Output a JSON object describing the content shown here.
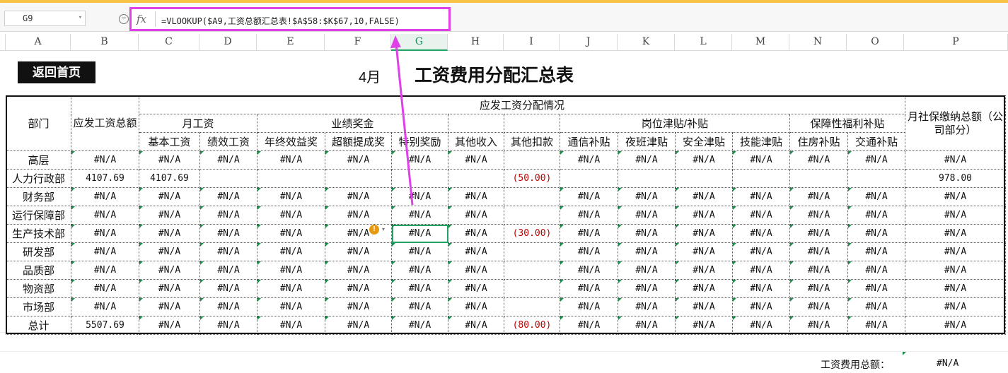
{
  "formula_bar": {
    "cell_ref": "G9",
    "fx_label": "fx",
    "formula": "=VLOOKUP($A9,工资总额汇总表!$A$58:$K$67,10,FALSE)"
  },
  "columns": [
    "A",
    "B",
    "C",
    "D",
    "E",
    "F",
    "G",
    "H",
    "I",
    "J",
    "K",
    "L",
    "M",
    "N",
    "O",
    "P"
  ],
  "selected_column": "G",
  "home_button": "返回首页",
  "month": "4月",
  "title": "工资费用分配汇总表",
  "headers": {
    "dept": "部门",
    "gross": "应发工资总额",
    "distribution": "应发工资分配情况",
    "monthly_wage": "月工资",
    "bonus": "业绩奖金",
    "post_allowance": "岗位津贴/补贴",
    "welfare": "保障性福利补贴",
    "social_security": "月社保缴纳总额（公司部分）",
    "sub": [
      "基本工资",
      "绩效工资",
      "年终效益奖",
      "超额提成奖",
      "特别奖励",
      "其他收入",
      "其他扣款",
      "通信补贴",
      "夜班津贴",
      "安全津贴",
      "技能津贴",
      "住房补贴",
      "交通补贴"
    ]
  },
  "rows": [
    {
      "dept": "高层",
      "cells": [
        "#N/A",
        "#N/A",
        "#N/A",
        "#N/A",
        "#N/A",
        "#N/A",
        "#N/A",
        "",
        "#N/A",
        "#N/A",
        "#N/A",
        "#N/A",
        "#N/A",
        "#N/A",
        "#N/A"
      ]
    },
    {
      "dept": "人力行政部",
      "cells": [
        "4107.69",
        "4107.69",
        "",
        "",
        "",
        "",
        "",
        "(50.00)",
        "",
        "",
        "",
        "",
        "",
        "",
        "978.00"
      ]
    },
    {
      "dept": "财务部",
      "cells": [
        "#N/A",
        "#N/A",
        "#N/A",
        "#N/A",
        "#N/A",
        "#N/A",
        "#N/A",
        "",
        "#N/A",
        "#N/A",
        "#N/A",
        "#N/A",
        "#N/A",
        "#N/A",
        "#N/A"
      ]
    },
    {
      "dept": "运行保障部",
      "cells": [
        "#N/A",
        "#N/A",
        "#N/A",
        "#N/A",
        "#N/A",
        "#N/A",
        "#N/A",
        "",
        "#N/A",
        "#N/A",
        "#N/A",
        "#N/A",
        "#N/A",
        "#N/A",
        "#N/A"
      ]
    },
    {
      "dept": "生产技术部",
      "cells": [
        "#N/A",
        "#N/A",
        "#N/A",
        "#N/A",
        "#N/A",
        "#N/A",
        "#N/A",
        "(30.00)",
        "#N/A",
        "#N/A",
        "#N/A",
        "#N/A",
        "#N/A",
        "#N/A",
        "#N/A"
      ]
    },
    {
      "dept": "研发部",
      "cells": [
        "#N/A",
        "#N/A",
        "#N/A",
        "#N/A",
        "#N/A",
        "#N/A",
        "#N/A",
        "",
        "#N/A",
        "#N/A",
        "#N/A",
        "#N/A",
        "#N/A",
        "#N/A",
        "#N/A"
      ]
    },
    {
      "dept": "品质部",
      "cells": [
        "#N/A",
        "#N/A",
        "#N/A",
        "#N/A",
        "#N/A",
        "#N/A",
        "#N/A",
        "",
        "#N/A",
        "#N/A",
        "#N/A",
        "#N/A",
        "#N/A",
        "#N/A",
        "#N/A"
      ]
    },
    {
      "dept": "物资部",
      "cells": [
        "#N/A",
        "#N/A",
        "#N/A",
        "#N/A",
        "#N/A",
        "#N/A",
        "#N/A",
        "",
        "#N/A",
        "#N/A",
        "#N/A",
        "#N/A",
        "#N/A",
        "#N/A",
        "#N/A"
      ]
    },
    {
      "dept": "市场部",
      "cells": [
        "#N/A",
        "#N/A",
        "#N/A",
        "#N/A",
        "#N/A",
        "#N/A",
        "#N/A",
        "",
        "#N/A",
        "#N/A",
        "#N/A",
        "#N/A",
        "#N/A",
        "#N/A",
        "#N/A"
      ]
    },
    {
      "dept": "总计",
      "cells": [
        "5507.69",
        "#N/A",
        "#N/A",
        "#N/A",
        "#N/A",
        "#N/A",
        "#N/A",
        "(80.00)",
        "#N/A",
        "#N/A",
        "#N/A",
        "#N/A",
        "#N/A",
        "#N/A",
        "#N/A"
      ]
    }
  ],
  "footer": {
    "label": "工资费用总额：",
    "value": "#N/A"
  },
  "warning_icon": "!",
  "colors": {
    "accent": "#21a366",
    "highlight": "#e040e8",
    "negative": "#c00000"
  }
}
